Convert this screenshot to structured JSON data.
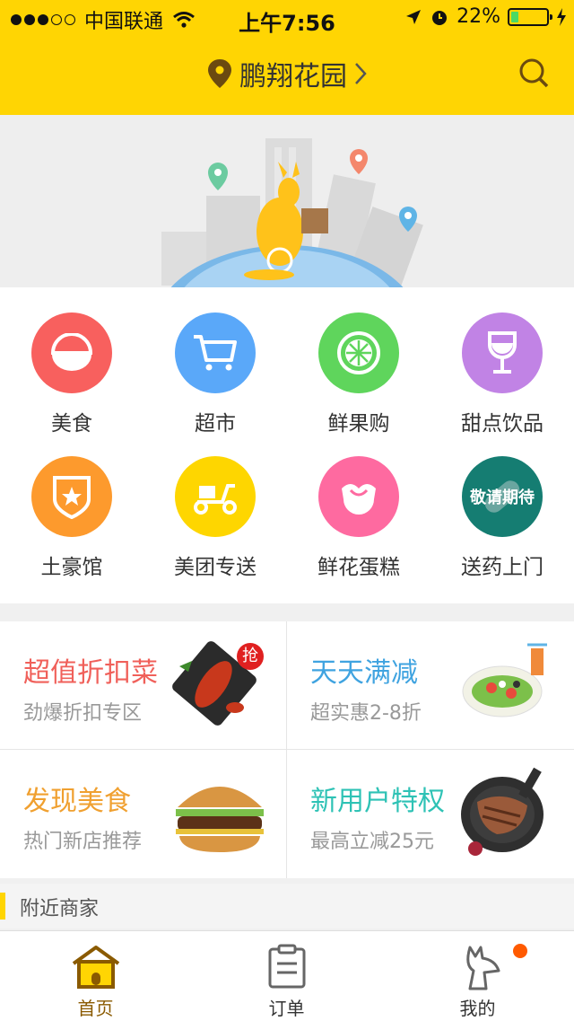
{
  "status_bar": {
    "carrier": "中国联通",
    "time": "上午7:56",
    "battery": "22%",
    "battery_level": 0.22
  },
  "header": {
    "location": "鹏翔花园"
  },
  "categories": [
    {
      "label": "美食",
      "color": "#f8605e",
      "icon": "rice-bowl-icon"
    },
    {
      "label": "超市",
      "color": "#5aa8f9",
      "icon": "cart-icon"
    },
    {
      "label": "鲜果购",
      "color": "#5fd55c",
      "icon": "lime-slice-icon"
    },
    {
      "label": "甜点饮品",
      "color": "#c183e5",
      "icon": "wine-glass-icon"
    },
    {
      "label": "土豪馆",
      "color": "#fd9a2d",
      "icon": "badge-star-icon"
    },
    {
      "label": "美团专送",
      "color": "#fed600",
      "icon": "scooter-icon"
    },
    {
      "label": "鲜花蛋糕",
      "color": "#fe6aa0",
      "icon": "flower-icon"
    },
    {
      "label": "送药上门",
      "color": "#157d72",
      "icon": "pill-icon",
      "overlay": "敬请期待"
    }
  ],
  "promos": [
    {
      "title": "超值折扣菜",
      "subtitle": "劲爆折扣专区",
      "title_color": "#f0605a",
      "badge": "抢",
      "image": "crayfish-plate"
    },
    {
      "title": "天天满减",
      "subtitle": "超实惠2-8折",
      "title_color": "#3fa3e0",
      "image": "salad-plate"
    },
    {
      "title": "发现美食",
      "subtitle": "热门新店推荐",
      "title_color": "#f0a030",
      "image": "burger"
    },
    {
      "title": "新用户特权",
      "subtitle": "最高立减25元",
      "title_color": "#2ec2b5",
      "image": "steak-pan"
    }
  ],
  "nearby": {
    "title": "附近商家"
  },
  "tabs": [
    {
      "label": "首页",
      "icon": "home-icon",
      "active": true
    },
    {
      "label": "订单",
      "icon": "clipboard-icon",
      "active": false
    },
    {
      "label": "我的",
      "icon": "kangaroo-profile-icon",
      "active": false,
      "has_badge": true
    }
  ],
  "colors": {
    "brand_yellow": "#ffd503"
  }
}
